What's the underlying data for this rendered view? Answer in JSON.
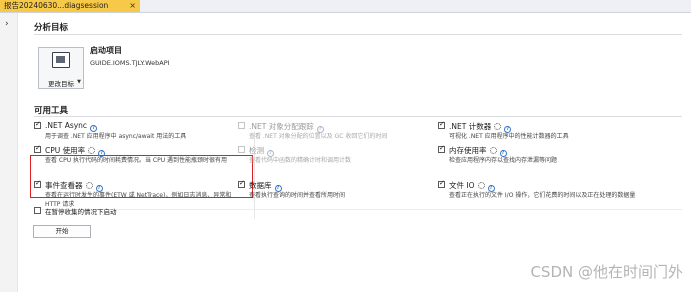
{
  "tab": {
    "title": "报告20240630...diagsession",
    "close": "×"
  },
  "gutter": {
    "chevron": "›"
  },
  "analysis_target": {
    "heading": "分析目标",
    "change_target_label": "更改目标",
    "startup_label": "启动项目",
    "startup_value": "GUIDE.IOMS.TJLY.WebAPI"
  },
  "tools_heading": "可用工具",
  "tools": {
    "net_async": {
      "name": ".NET Async",
      "checked": true,
      "enabled": true,
      "icons": [
        "help-icon"
      ],
      "desc": "用于调查 .NET 应用程序中 async/await 用法的工具"
    },
    "net_alloc": {
      "name": ".NET 对象分配跟踪",
      "checked": false,
      "enabled": false,
      "icons": [
        "help-icon"
      ],
      "desc": "查看 .NET 对象分配的位置以及 GC 收回它们的时间"
    },
    "net_counter": {
      "name": ".NET 计数器",
      "checked": true,
      "enabled": true,
      "icons": [
        "gear-icon",
        "help-icon"
      ],
      "desc": "可视化 .NET 应用程序中的性能计数器的工具"
    },
    "cpu": {
      "name": "CPU 使用率",
      "checked": true,
      "enabled": true,
      "icons": [
        "gear-icon",
        "help-icon"
      ],
      "desc": "查看 CPU 执行代码的时间耗费情况。当 CPU 遇到性能瓶颈时很有用"
    },
    "instrument": {
      "name": "检测",
      "checked": false,
      "enabled": false,
      "icons": [
        "help-icon"
      ],
      "desc": "查看代码中函数的精确计时和调用计数"
    },
    "memory": {
      "name": "内存使用率",
      "checked": true,
      "enabled": true,
      "icons": [
        "gear-icon",
        "help-icon"
      ],
      "desc": "检查应用程序内存以查找内存泄漏等问题"
    },
    "events": {
      "name": "事件查看器",
      "checked": true,
      "enabled": true,
      "icons": [
        "gear-icon",
        "help-icon"
      ],
      "desc": "查看在运行时发生的事件(ETW 或 NetTrace)，例如日志消息、异常和 HTTP 请求"
    },
    "database": {
      "name": "数据库",
      "checked": true,
      "enabled": true,
      "icons": [
        "help-icon"
      ],
      "desc": "查看执行查询的时间并查看所用时间"
    },
    "file_io": {
      "name": "文件 IO",
      "checked": true,
      "enabled": true,
      "icons": [
        "gear-icon",
        "help-icon"
      ],
      "desc": "查看正在执行的文件 I/O 操作，它们花费的时间以及正在处理的数据量"
    }
  },
  "pause_option": {
    "label": "在暂停收集的情况下启动",
    "checked": false
  },
  "start_button": "开始",
  "watermark": "CSDN @他在时间门外",
  "colors": {
    "tab_active": "#f7c948",
    "highlight_border": "#e02020",
    "help_icon": "#3a78c9"
  }
}
